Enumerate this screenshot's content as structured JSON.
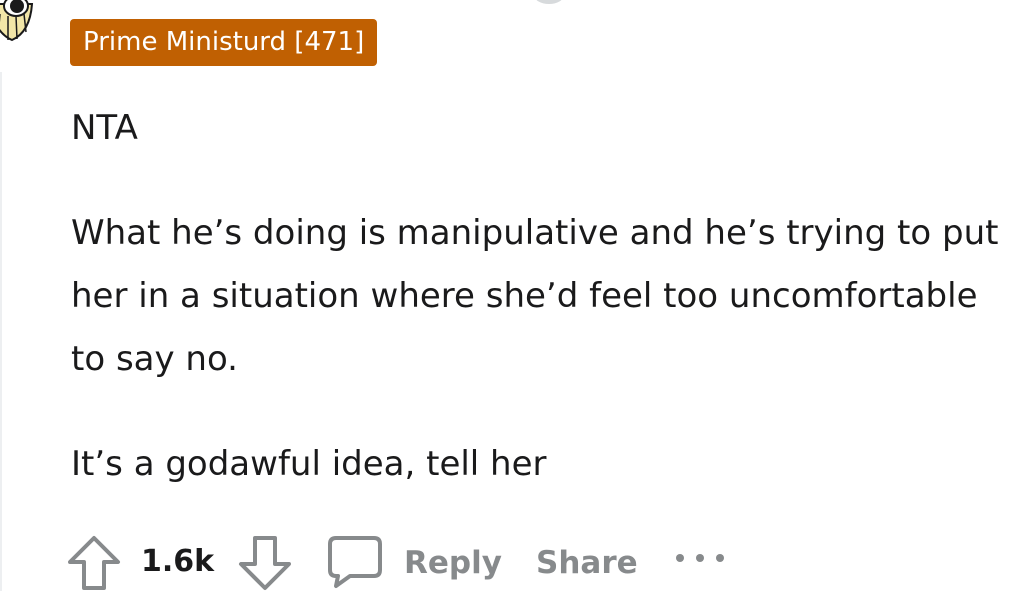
{
  "comment": {
    "flair": "Prime Ministurd [471]",
    "paragraphs": [
      "NTA",
      "What he’s doing is manipulative and he’s trying to put her in a situation where she’d feel too uncomfortable to say no.",
      "It’s a godawful idea, tell her"
    ]
  },
  "actions": {
    "vote_count": "1.6k",
    "reply_label": "Reply",
    "share_label": "Share",
    "more_icon": "ellipsis-icon",
    "upvote_icon": "upvote-arrow-icon",
    "downvote_icon": "downvote-arrow-icon",
    "comment_icon": "comment-bubble-icon"
  },
  "colors": {
    "flair_bg": "#c06002",
    "text": "#1a1a1b",
    "muted": "#878a8c"
  }
}
